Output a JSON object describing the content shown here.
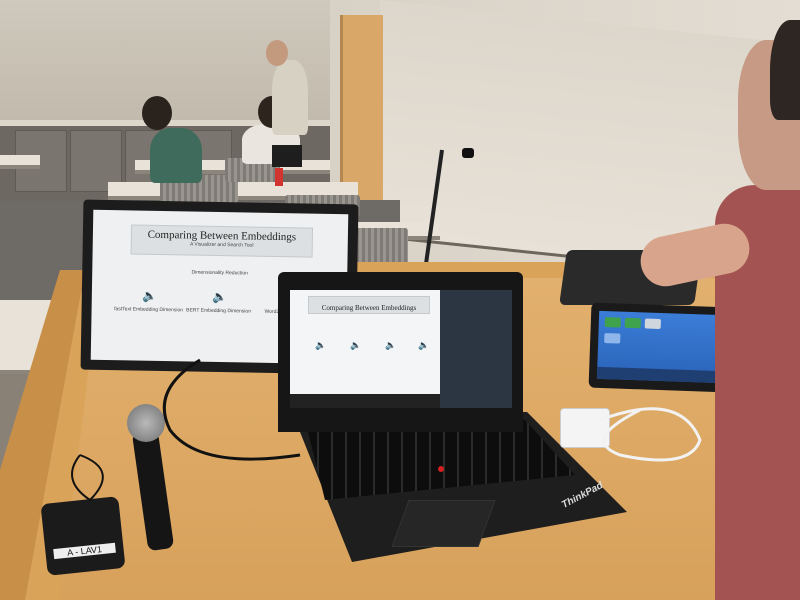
{
  "monitor_slide": {
    "title": "Comparing Between Embeddings",
    "subtitle": "A Visualizer and Search Tool",
    "section": "Dimensionality Reduction",
    "items": [
      {
        "icon": "speaker-icon",
        "label": "fastText Embedding Dimension"
      },
      {
        "icon": "speaker-icon",
        "label": "BERT Embedding Dimension"
      },
      {
        "icon": "speaker-icon",
        "label": "Word2Vec Dimension"
      }
    ]
  },
  "laptop_slide": {
    "title": "Comparing Between Embeddings"
  },
  "receiver_label": "A - LAV1",
  "laptop_brand": "ThinkPad",
  "colors": {
    "podium": "#d9a35a",
    "tablet_screen": "#3b7dd8",
    "shirt": "#a35452"
  }
}
